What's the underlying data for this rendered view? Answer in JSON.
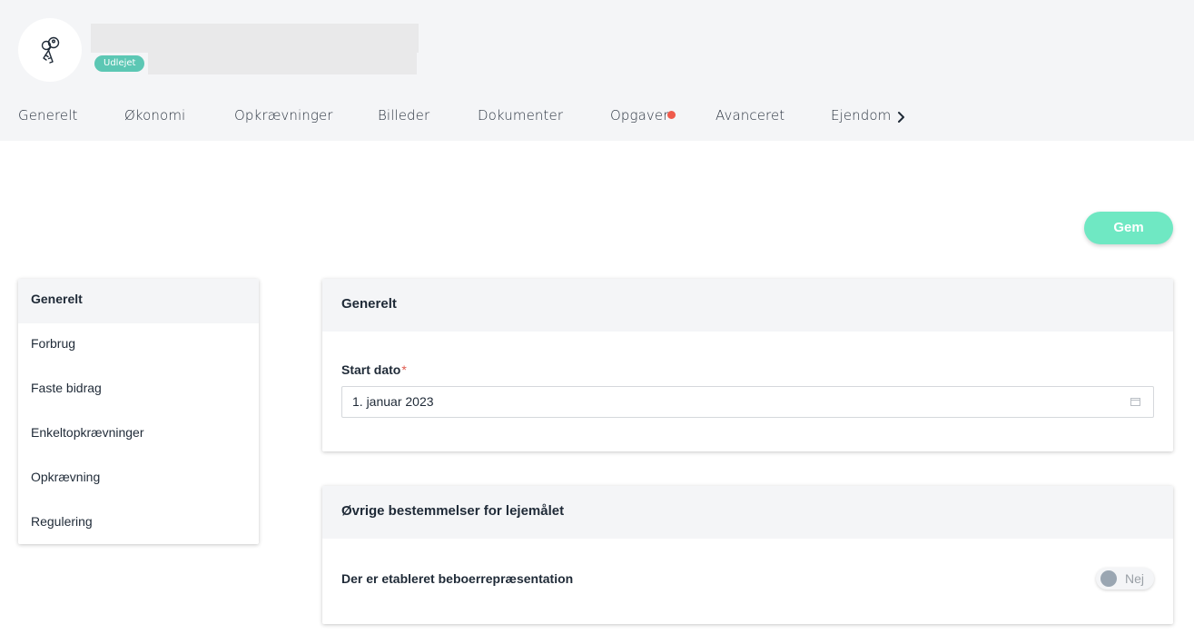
{
  "header": {
    "status_badge": "Udlejet",
    "avatar_icon": "keys-icon"
  },
  "tabs": [
    {
      "label": "Generelt"
    },
    {
      "label": "Økonomi"
    },
    {
      "label": "Opkrævninger"
    },
    {
      "label": "Billeder"
    },
    {
      "label": "Dokumenter"
    },
    {
      "label": "Opgaver",
      "has_notification": true
    },
    {
      "label": "Avanceret"
    },
    {
      "label": "Ejendom"
    }
  ],
  "actions": {
    "save_label": "Gem"
  },
  "side_menu": {
    "items": [
      {
        "label": "Generelt",
        "active": true
      },
      {
        "label": "Forbrug"
      },
      {
        "label": "Faste bidrag"
      },
      {
        "label": "Enkeltopkrævninger"
      },
      {
        "label": "Opkrævning"
      },
      {
        "label": "Regulering"
      }
    ]
  },
  "general_card": {
    "title": "Generelt",
    "start_date_label": "Start dato",
    "required_marker": "*",
    "start_date_value": "1. januar 2023"
  },
  "other_card": {
    "title": "Øvrige bestemmelser for lejemålet",
    "representation_label": "Der er etableret beboerrepræsentation",
    "representation_value": "Nej",
    "representation_enabled": false
  },
  "colors": {
    "accent": "#6fe8c3",
    "badge": "#5cc7b4",
    "notification": "#ef5b4c",
    "header_bg": "#f4f5f7"
  }
}
